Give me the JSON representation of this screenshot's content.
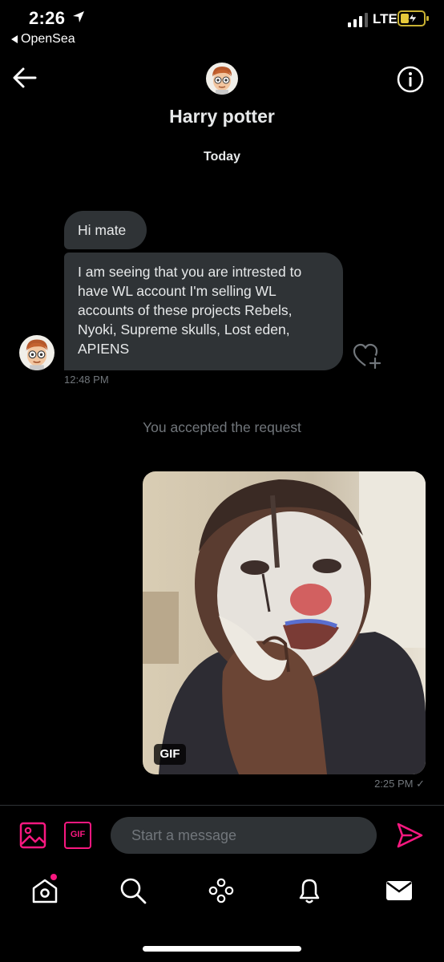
{
  "status_bar": {
    "time": "2:26",
    "back_app": "OpenSea",
    "network": "LTE"
  },
  "header": {
    "name": "Harry potter"
  },
  "conversation": {
    "day_label": "Today",
    "messages": [
      {
        "text": "Hi mate"
      },
      {
        "text": "I am seeing that you are intrested to have WL account I'm selling WL accounts of these projects Rebels, Nyoki, Supreme skulls, Lost eden, APIENS"
      }
    ],
    "incoming_time": "12:48 PM",
    "system_notice": "You accepted the request",
    "gif_badge": "GIF",
    "outgoing_time": "2:25 PM ✓"
  },
  "composer": {
    "gif_label": "GIF",
    "placeholder": "Start a message"
  },
  "colors": {
    "accent": "#f91880",
    "bubble": "#2f3336",
    "muted": "#71767b",
    "background": "#000000"
  },
  "icons": [
    "location-arrow-icon",
    "signal-bars-icon",
    "battery-charging-icon",
    "back-arrow-icon",
    "info-icon",
    "heart-plus-icon",
    "image-icon",
    "send-icon",
    "home-icon",
    "search-icon",
    "spaces-icon",
    "bell-icon",
    "mail-icon"
  ]
}
